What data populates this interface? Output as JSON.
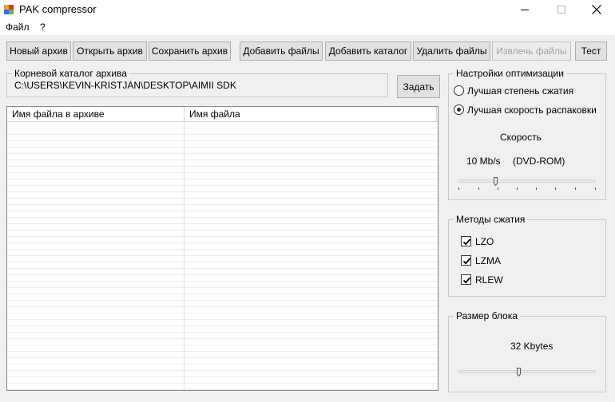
{
  "window": {
    "title": "PAK compressor"
  },
  "menu": {
    "file": "Файл",
    "help": "?"
  },
  "toolbar": {
    "new_archive": "Новый архив",
    "open_archive": "Открыть архив",
    "save_archive": "Сохранить архив",
    "add_files": "Добавить файлы",
    "add_folder": "Добавить каталог",
    "delete_files": "Удалить файлы",
    "extract_files": "Извлечь файлы",
    "test": "Тест"
  },
  "root_dir": {
    "title": "Корневой каталог архива",
    "path": "C:\\USERS\\KEVIN-KRISTJAN\\DESKTOP\\AIMII SDK",
    "set_button": "Задать"
  },
  "file_list": {
    "columns": [
      "Имя файла в архиве",
      "Имя файла"
    ],
    "rows": []
  },
  "optimization": {
    "title": "Настройки оптимизации",
    "options": [
      {
        "label": "Лучшая степень сжатия",
        "selected": false
      },
      {
        "label": "Лучшая скорость распаковки",
        "selected": true
      }
    ],
    "speed_label": "Скорость",
    "speed_value": "10 Mb/s",
    "speed_device": "(DVD-ROM)",
    "slider_level": 0.27
  },
  "compression_methods": {
    "title": "Методы сжатия",
    "methods": [
      {
        "label": "LZO",
        "checked": true
      },
      {
        "label": "LZMA",
        "checked": true
      },
      {
        "label": "RLEW",
        "checked": true
      }
    ]
  },
  "block_size": {
    "title": "Размер блока",
    "value": "32 Kbytes",
    "slider_level": 0.45
  },
  "colors": {
    "disabled_text": "#a0a0a0",
    "window_bg": "#f0f0f0"
  },
  "icons": {
    "app": "app-icon",
    "minimize": "minimize-icon",
    "maximize": "maximize-icon",
    "close": "close-icon",
    "check": "check-icon"
  }
}
